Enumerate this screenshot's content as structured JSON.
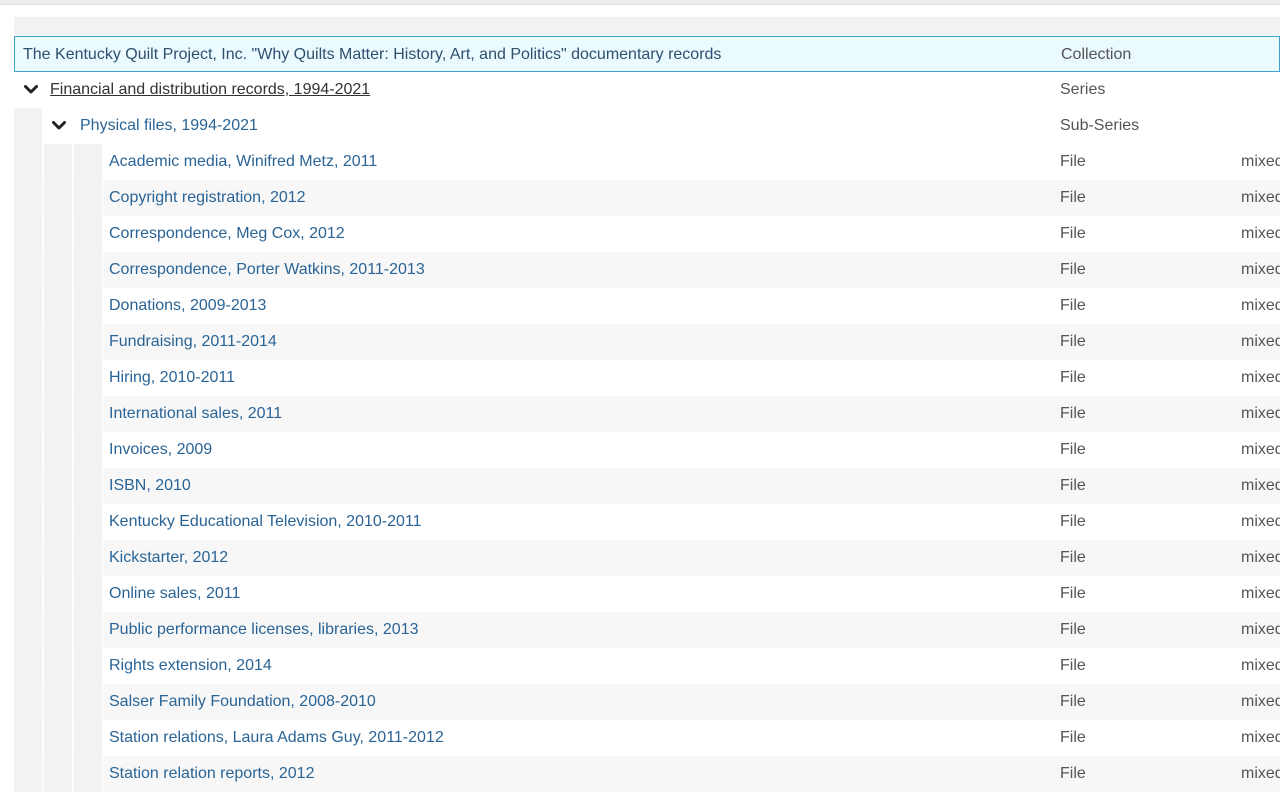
{
  "collection": {
    "title": "The Kentucky Quilt Project, Inc. \"Why Quilts Matter: History, Art, and Politics\" documentary records",
    "type": "Collection"
  },
  "series": {
    "title": "Financial and distribution records, 1994-2021",
    "type": "Series",
    "toggle_icon": "chevron-down-icon"
  },
  "subseries": {
    "title": "Physical files, 1994-2021",
    "type": "Sub-Series",
    "toggle_icon": "chevron-down-icon"
  },
  "files": [
    {
      "title": "Academic media, Winifred Metz, 2011",
      "type": "File",
      "extent": "mixed"
    },
    {
      "title": "Copyright registration, 2012",
      "type": "File",
      "extent": "mixed"
    },
    {
      "title": "Correspondence, Meg Cox, 2012",
      "type": "File",
      "extent": "mixed"
    },
    {
      "title": "Correspondence, Porter Watkins, 2011-2013",
      "type": "File",
      "extent": "mixed"
    },
    {
      "title": "Donations, 2009-2013",
      "type": "File",
      "extent": "mixed"
    },
    {
      "title": "Fundraising, 2011-2014",
      "type": "File",
      "extent": "mixed"
    },
    {
      "title": "Hiring, 2010-2011",
      "type": "File",
      "extent": "mixed"
    },
    {
      "title": "International sales, 2011",
      "type": "File",
      "extent": "mixed"
    },
    {
      "title": "Invoices, 2009",
      "type": "File",
      "extent": "mixed"
    },
    {
      "title": "ISBN, 2010",
      "type": "File",
      "extent": "mixed"
    },
    {
      "title": "Kentucky Educational Television, 2010-2011",
      "type": "File",
      "extent": "mixed"
    },
    {
      "title": "Kickstarter, 2012",
      "type": "File",
      "extent": "mixed"
    },
    {
      "title": "Online sales, 2011",
      "type": "File",
      "extent": "mixed"
    },
    {
      "title": "Public performance licenses, libraries, 2013",
      "type": "File",
      "extent": "mixed"
    },
    {
      "title": "Rights extension, 2014",
      "type": "File",
      "extent": "mixed"
    },
    {
      "title": "Salser Family Foundation, 2008-2010",
      "type": "File",
      "extent": "mixed"
    },
    {
      "title": "Station relations, Laura Adams Guy, 2011-2012",
      "type": "File",
      "extent": "mixed"
    },
    {
      "title": "Station relation reports, 2012",
      "type": "File",
      "extent": "mixed"
    }
  ]
}
